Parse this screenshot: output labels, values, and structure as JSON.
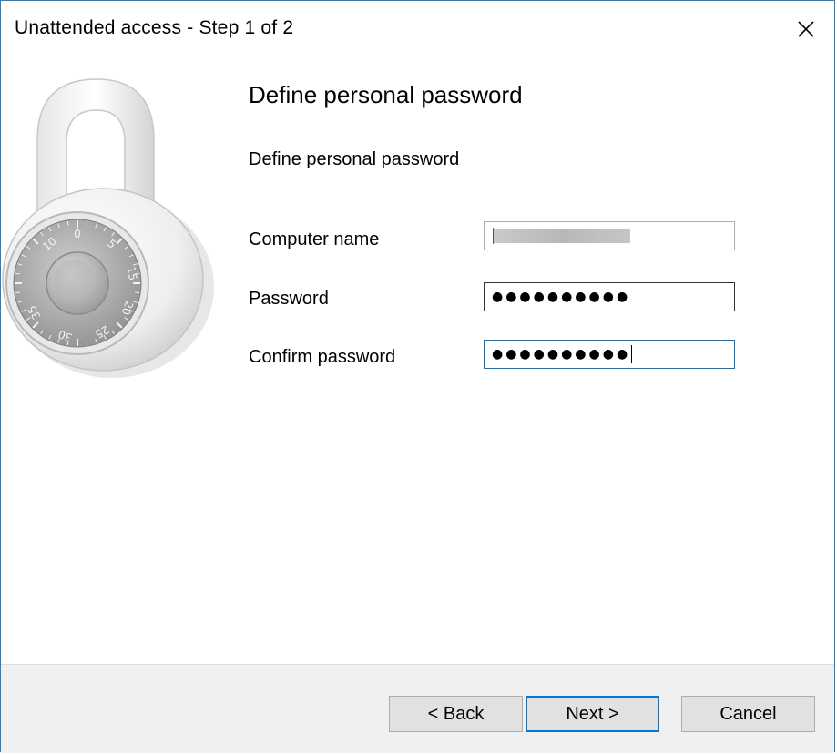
{
  "window": {
    "title": "Unattended access - Step 1 of 2"
  },
  "icons": {
    "close": "close-icon",
    "illustration": "combination-padlock-icon"
  },
  "page": {
    "heading": "Define personal password",
    "description": "Define personal password"
  },
  "lock_dial": {
    "numbers": [
      "0",
      "5",
      "10",
      "15",
      "20",
      "25",
      "30",
      "35"
    ]
  },
  "form": {
    "computer_name": {
      "label": "Computer name",
      "value": ""
    },
    "password": {
      "label": "Password",
      "value": "●●●●●●●●●●"
    },
    "confirm_password": {
      "label": "Confirm password",
      "value": "●●●●●●●●●●"
    }
  },
  "buttons": {
    "back": "< Back",
    "next": "Next >",
    "cancel": "Cancel"
  },
  "colors": {
    "accent": "#0078d7",
    "footer": "#f0f0f0",
    "button": "#e1e1e1"
  }
}
